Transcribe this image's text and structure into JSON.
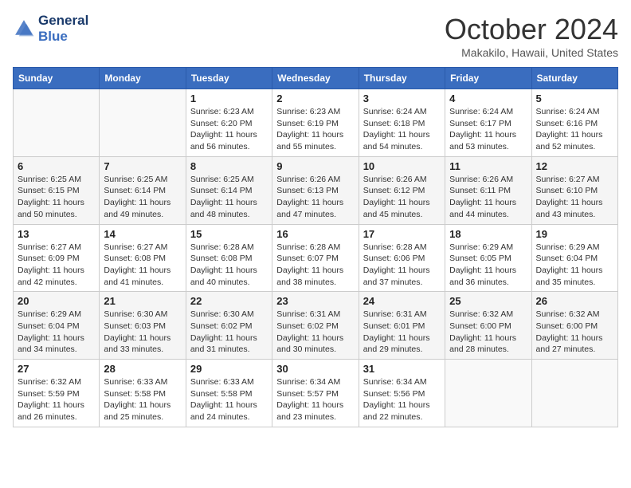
{
  "header": {
    "logo_line1": "General",
    "logo_line2": "Blue",
    "month_title": "October 2024",
    "location": "Makakilo, Hawaii, United States"
  },
  "weekdays": [
    "Sunday",
    "Monday",
    "Tuesday",
    "Wednesday",
    "Thursday",
    "Friday",
    "Saturday"
  ],
  "weeks": [
    [
      {
        "day": "",
        "sunrise": "",
        "sunset": "",
        "daylight": ""
      },
      {
        "day": "",
        "sunrise": "",
        "sunset": "",
        "daylight": ""
      },
      {
        "day": "1",
        "sunrise": "Sunrise: 6:23 AM",
        "sunset": "Sunset: 6:20 PM",
        "daylight": "Daylight: 11 hours and 56 minutes."
      },
      {
        "day": "2",
        "sunrise": "Sunrise: 6:23 AM",
        "sunset": "Sunset: 6:19 PM",
        "daylight": "Daylight: 11 hours and 55 minutes."
      },
      {
        "day": "3",
        "sunrise": "Sunrise: 6:24 AM",
        "sunset": "Sunset: 6:18 PM",
        "daylight": "Daylight: 11 hours and 54 minutes."
      },
      {
        "day": "4",
        "sunrise": "Sunrise: 6:24 AM",
        "sunset": "Sunset: 6:17 PM",
        "daylight": "Daylight: 11 hours and 53 minutes."
      },
      {
        "day": "5",
        "sunrise": "Sunrise: 6:24 AM",
        "sunset": "Sunset: 6:16 PM",
        "daylight": "Daylight: 11 hours and 52 minutes."
      }
    ],
    [
      {
        "day": "6",
        "sunrise": "Sunrise: 6:25 AM",
        "sunset": "Sunset: 6:15 PM",
        "daylight": "Daylight: 11 hours and 50 minutes."
      },
      {
        "day": "7",
        "sunrise": "Sunrise: 6:25 AM",
        "sunset": "Sunset: 6:14 PM",
        "daylight": "Daylight: 11 hours and 49 minutes."
      },
      {
        "day": "8",
        "sunrise": "Sunrise: 6:25 AM",
        "sunset": "Sunset: 6:14 PM",
        "daylight": "Daylight: 11 hours and 48 minutes."
      },
      {
        "day": "9",
        "sunrise": "Sunrise: 6:26 AM",
        "sunset": "Sunset: 6:13 PM",
        "daylight": "Daylight: 11 hours and 47 minutes."
      },
      {
        "day": "10",
        "sunrise": "Sunrise: 6:26 AM",
        "sunset": "Sunset: 6:12 PM",
        "daylight": "Daylight: 11 hours and 45 minutes."
      },
      {
        "day": "11",
        "sunrise": "Sunrise: 6:26 AM",
        "sunset": "Sunset: 6:11 PM",
        "daylight": "Daylight: 11 hours and 44 minutes."
      },
      {
        "day": "12",
        "sunrise": "Sunrise: 6:27 AM",
        "sunset": "Sunset: 6:10 PM",
        "daylight": "Daylight: 11 hours and 43 minutes."
      }
    ],
    [
      {
        "day": "13",
        "sunrise": "Sunrise: 6:27 AM",
        "sunset": "Sunset: 6:09 PM",
        "daylight": "Daylight: 11 hours and 42 minutes."
      },
      {
        "day": "14",
        "sunrise": "Sunrise: 6:27 AM",
        "sunset": "Sunset: 6:08 PM",
        "daylight": "Daylight: 11 hours and 41 minutes."
      },
      {
        "day": "15",
        "sunrise": "Sunrise: 6:28 AM",
        "sunset": "Sunset: 6:08 PM",
        "daylight": "Daylight: 11 hours and 40 minutes."
      },
      {
        "day": "16",
        "sunrise": "Sunrise: 6:28 AM",
        "sunset": "Sunset: 6:07 PM",
        "daylight": "Daylight: 11 hours and 38 minutes."
      },
      {
        "day": "17",
        "sunrise": "Sunrise: 6:28 AM",
        "sunset": "Sunset: 6:06 PM",
        "daylight": "Daylight: 11 hours and 37 minutes."
      },
      {
        "day": "18",
        "sunrise": "Sunrise: 6:29 AM",
        "sunset": "Sunset: 6:05 PM",
        "daylight": "Daylight: 11 hours and 36 minutes."
      },
      {
        "day": "19",
        "sunrise": "Sunrise: 6:29 AM",
        "sunset": "Sunset: 6:04 PM",
        "daylight": "Daylight: 11 hours and 35 minutes."
      }
    ],
    [
      {
        "day": "20",
        "sunrise": "Sunrise: 6:29 AM",
        "sunset": "Sunset: 6:04 PM",
        "daylight": "Daylight: 11 hours and 34 minutes."
      },
      {
        "day": "21",
        "sunrise": "Sunrise: 6:30 AM",
        "sunset": "Sunset: 6:03 PM",
        "daylight": "Daylight: 11 hours and 33 minutes."
      },
      {
        "day": "22",
        "sunrise": "Sunrise: 6:30 AM",
        "sunset": "Sunset: 6:02 PM",
        "daylight": "Daylight: 11 hours and 31 minutes."
      },
      {
        "day": "23",
        "sunrise": "Sunrise: 6:31 AM",
        "sunset": "Sunset: 6:02 PM",
        "daylight": "Daylight: 11 hours and 30 minutes."
      },
      {
        "day": "24",
        "sunrise": "Sunrise: 6:31 AM",
        "sunset": "Sunset: 6:01 PM",
        "daylight": "Daylight: 11 hours and 29 minutes."
      },
      {
        "day": "25",
        "sunrise": "Sunrise: 6:32 AM",
        "sunset": "Sunset: 6:00 PM",
        "daylight": "Daylight: 11 hours and 28 minutes."
      },
      {
        "day": "26",
        "sunrise": "Sunrise: 6:32 AM",
        "sunset": "Sunset: 6:00 PM",
        "daylight": "Daylight: 11 hours and 27 minutes."
      }
    ],
    [
      {
        "day": "27",
        "sunrise": "Sunrise: 6:32 AM",
        "sunset": "Sunset: 5:59 PM",
        "daylight": "Daylight: 11 hours and 26 minutes."
      },
      {
        "day": "28",
        "sunrise": "Sunrise: 6:33 AM",
        "sunset": "Sunset: 5:58 PM",
        "daylight": "Daylight: 11 hours and 25 minutes."
      },
      {
        "day": "29",
        "sunrise": "Sunrise: 6:33 AM",
        "sunset": "Sunset: 5:58 PM",
        "daylight": "Daylight: 11 hours and 24 minutes."
      },
      {
        "day": "30",
        "sunrise": "Sunrise: 6:34 AM",
        "sunset": "Sunset: 5:57 PM",
        "daylight": "Daylight: 11 hours and 23 minutes."
      },
      {
        "day": "31",
        "sunrise": "Sunrise: 6:34 AM",
        "sunset": "Sunset: 5:56 PM",
        "daylight": "Daylight: 11 hours and 22 minutes."
      },
      {
        "day": "",
        "sunrise": "",
        "sunset": "",
        "daylight": ""
      },
      {
        "day": "",
        "sunrise": "",
        "sunset": "",
        "daylight": ""
      }
    ]
  ]
}
